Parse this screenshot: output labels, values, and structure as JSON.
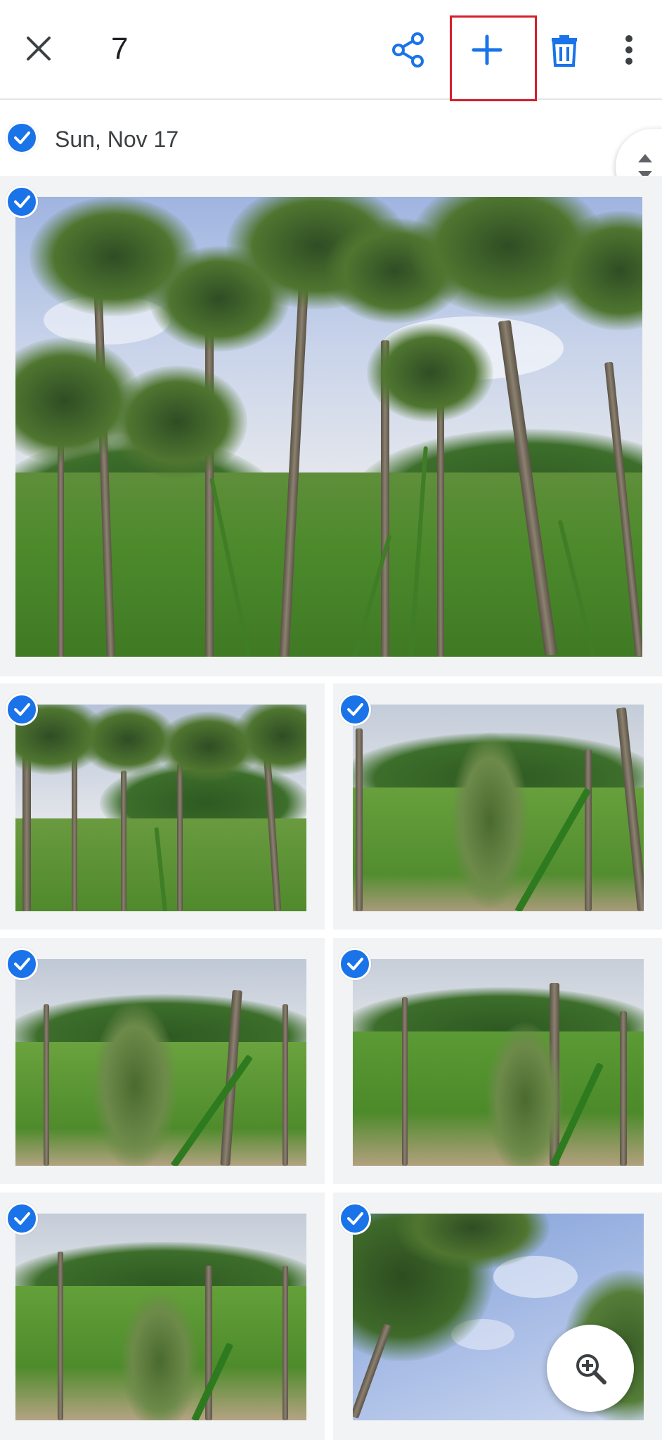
{
  "app_bar": {
    "selected_count": "7",
    "close_icon": "close-icon",
    "share_icon": "share-icon",
    "add_icon": "plus-icon",
    "delete_icon": "trash-icon",
    "more_icon": "more-vert-icon"
  },
  "date_group": {
    "label": "Sun, Nov 17",
    "selected": true
  },
  "photos": [
    {
      "selected": true,
      "scene": "coconut-palm-grove"
    },
    {
      "selected": true,
      "scene": "palm-grove-field"
    },
    {
      "selected": true,
      "scene": "grass-flower-closeup"
    },
    {
      "selected": true,
      "scene": "grass-flower-closeup"
    },
    {
      "selected": true,
      "scene": "grass-flower-closeup"
    },
    {
      "selected": true,
      "scene": "grass-flower-closeup"
    },
    {
      "selected": true,
      "scene": "palm-canopy-sky"
    }
  ],
  "fab": {
    "icon": "zoom-in-icon"
  },
  "colors": {
    "accent": "#1a73e8",
    "highlight": "#d3202a",
    "icon_dark": "#3c4043"
  }
}
